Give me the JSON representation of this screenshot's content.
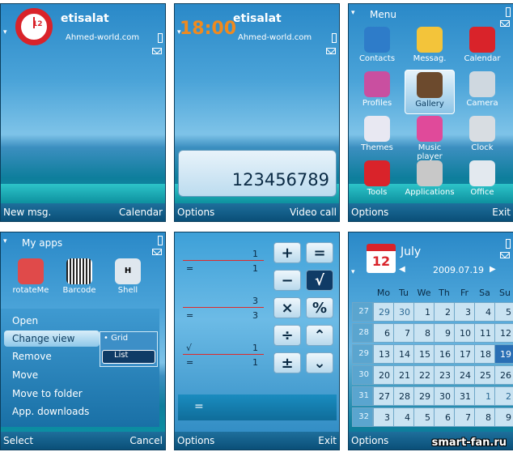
{
  "screen1": {
    "operator": "etisalat",
    "domain": "Ahmed-world.com",
    "clock_number": "12",
    "left_soft": "New msg.",
    "right_soft": "Calendar"
  },
  "screen2": {
    "time": "18:00",
    "operator": "etisalat",
    "domain": "Ahmed-world.com",
    "dial_number": "123456789",
    "left_soft": "Options",
    "right_soft": "Video call"
  },
  "screen3": {
    "title": "Menu",
    "apps": [
      {
        "label": "Contacts",
        "icon": "contacts-icon",
        "color": "#2e7cc9"
      },
      {
        "label": "Messag.",
        "icon": "message-icon",
        "color": "#f3c43a"
      },
      {
        "label": "Calendar",
        "icon": "calendar-icon",
        "color": "#d9232a"
      },
      {
        "label": "Profiles",
        "icon": "profiles-icon",
        "color": "#c94fa0"
      },
      {
        "label": "Gallery",
        "icon": "gallery-icon",
        "color": "#6c4a2d"
      },
      {
        "label": "Camera",
        "icon": "camera-icon",
        "color": "#cfd8e0"
      },
      {
        "label": "Themes",
        "icon": "themes-icon",
        "color": "#e8e8f2"
      },
      {
        "label": "Music player",
        "icon": "music-icon",
        "color": "#e04a9a"
      },
      {
        "label": "Clock",
        "icon": "clock-icon",
        "color": "#d8dde2"
      },
      {
        "label": "Tools",
        "icon": "tools-icon",
        "color": "#d9232a"
      },
      {
        "label": "Applications",
        "icon": "applications-icon",
        "color": "#c8c8c8"
      },
      {
        "label": "Office",
        "icon": "office-icon",
        "color": "#e3e9ef"
      }
    ],
    "left_soft": "Options",
    "right_soft": "Exit"
  },
  "screen4": {
    "title": "My apps",
    "apps": [
      "rotateMe",
      "Barcode",
      "Shell"
    ],
    "menu_items": [
      "Open",
      "Change view",
      "Remove",
      "Move",
      "Move to folder",
      "App. downloads"
    ],
    "submenu": [
      "Grid",
      "List"
    ],
    "left_soft": "Select",
    "right_soft": "Cancel"
  },
  "screen5": {
    "lines": [
      {
        "op": "",
        "value": "1"
      },
      {
        "op": "=",
        "value": "1"
      },
      {
        "op": "",
        "value": "3"
      },
      {
        "op": "=",
        "value": "3"
      },
      {
        "op": "√",
        "value": "1"
      },
      {
        "op": "=",
        "value": "1"
      }
    ],
    "keys": [
      "+",
      "=",
      "−",
      "√",
      "×",
      "%",
      "÷",
      "⌃",
      "±",
      "⌄"
    ],
    "display_op": "=",
    "left_soft": "Options",
    "right_soft": "Exit"
  },
  "screen6": {
    "month": "July",
    "date": "2009.07.19",
    "weekdays": [
      "Mo",
      "Tu",
      "We",
      "Th",
      "Fr",
      "Sa",
      "Su"
    ],
    "weeks": [
      {
        "wk": "27",
        "days": [
          "29",
          "30",
          "1",
          "2",
          "3",
          "4",
          "5"
        ]
      },
      {
        "wk": "28",
        "days": [
          "6",
          "7",
          "8",
          "9",
          "10",
          "11",
          "12"
        ]
      },
      {
        "wk": "29",
        "days": [
          "13",
          "14",
          "15",
          "16",
          "17",
          "18",
          "19"
        ]
      },
      {
        "wk": "30",
        "days": [
          "20",
          "21",
          "22",
          "23",
          "24",
          "25",
          "26"
        ]
      },
      {
        "wk": "31",
        "days": [
          "27",
          "28",
          "29",
          "30",
          "31",
          "1",
          "2"
        ]
      },
      {
        "wk": "32",
        "days": [
          "3",
          "4",
          "5",
          "6",
          "7",
          "8",
          "9"
        ]
      }
    ],
    "left_soft": "Options"
  },
  "watermark": "smart-fan.ru"
}
